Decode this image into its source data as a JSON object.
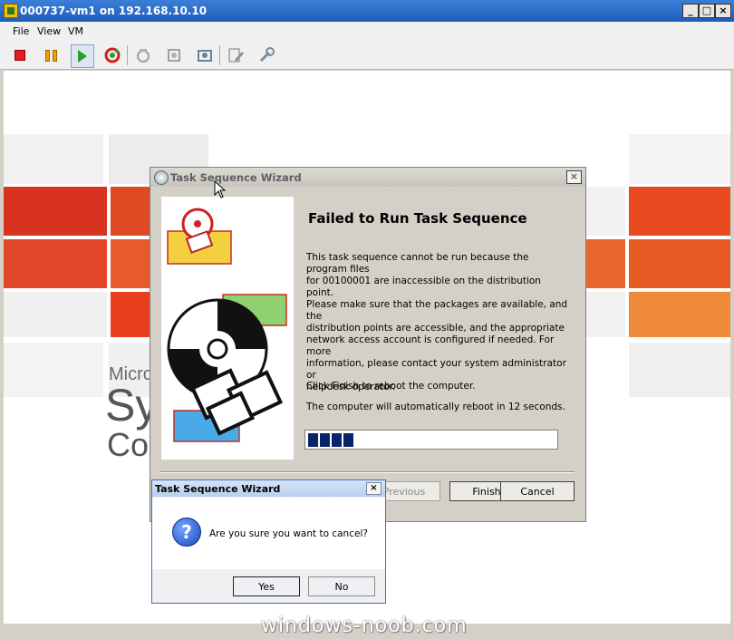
{
  "window": {
    "title": "000737-vm1 on 192.168.10.10",
    "min": "_",
    "max": "□",
    "close": "×"
  },
  "menu": {
    "items": [
      "File",
      "View",
      "VM"
    ]
  },
  "toolbar": {
    "icons": [
      "stop-icon",
      "pause-icon",
      "play-icon",
      "reset-icon",
      "snapshot-icon",
      "revert-icon",
      "manage-snapshots-icon",
      "edit-settings-icon",
      "console-options-icon"
    ],
    "colors": {
      "stop": "#e02020",
      "pause": "#f0a000",
      "play": "#2aa02a"
    }
  },
  "background": {
    "brand_lines": [
      "Micro",
      "Sy",
      "Co"
    ]
  },
  "wizard": {
    "title": "Task Sequence Wizard",
    "close": "×",
    "heading": "Failed to Run Task Sequence",
    "body_lines": [
      "This task sequence cannot be run because the program files",
      "for 00100001 are inaccessible on the distribution point.",
      "Please make sure that the packages are available, and the",
      "distribution points are accessible, and the appropriate",
      "network access account is configured if needed. For more",
      "information, please contact your system administrator or",
      "helpdesk operator."
    ],
    "finish_note": "Click Finish to reboot the computer.",
    "reboot_note": "The computer will automatically reboot in 12 seconds.",
    "progress_segments": 4,
    "buttons": {
      "previous": "Previous",
      "finish": "Finish",
      "cancel": "Cancel"
    }
  },
  "confirm": {
    "title": "Task Sequence Wizard",
    "close": "×",
    "message": "Are you sure you want to cancel?",
    "yes": "Yes",
    "no": "No"
  },
  "watermark": "windows-noob.com"
}
